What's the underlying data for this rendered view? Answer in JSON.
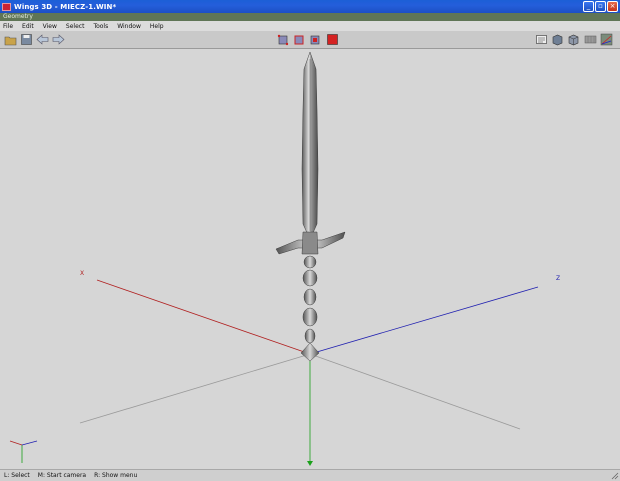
{
  "window": {
    "title": "Wings 3D - MIECZ-1.WIN*",
    "buttons": [
      "_",
      "▫",
      "×"
    ]
  },
  "geometry_bar": {
    "label": "Geometry"
  },
  "menu": {
    "items": [
      "File",
      "Edit",
      "View",
      "Select",
      "Tools",
      "Window",
      "Help"
    ]
  },
  "toolbar": {
    "left_icons": [
      "open-icon",
      "save-icon",
      "undo-icon",
      "redo-icon"
    ],
    "mode_icons": [
      "vertex-mode-icon",
      "edge-mode-icon",
      "face-mode-icon",
      "body-mode-icon"
    ],
    "right_icons": [
      "wireframe-icon",
      "smooth-shade-icon",
      "perspective-icon",
      "axes-icon",
      "grid-icon"
    ]
  },
  "viewport": {
    "axis_labels": {
      "x": "X",
      "z": "Z"
    },
    "colors": {
      "x_axis": "#b02020",
      "y_axis": "#1aa01a",
      "z_axis": "#2020b0",
      "background": "#d6d6d6"
    }
  },
  "status": {
    "left": "L: Select",
    "middle": "M: Start camera",
    "right": "R: Show menu"
  }
}
